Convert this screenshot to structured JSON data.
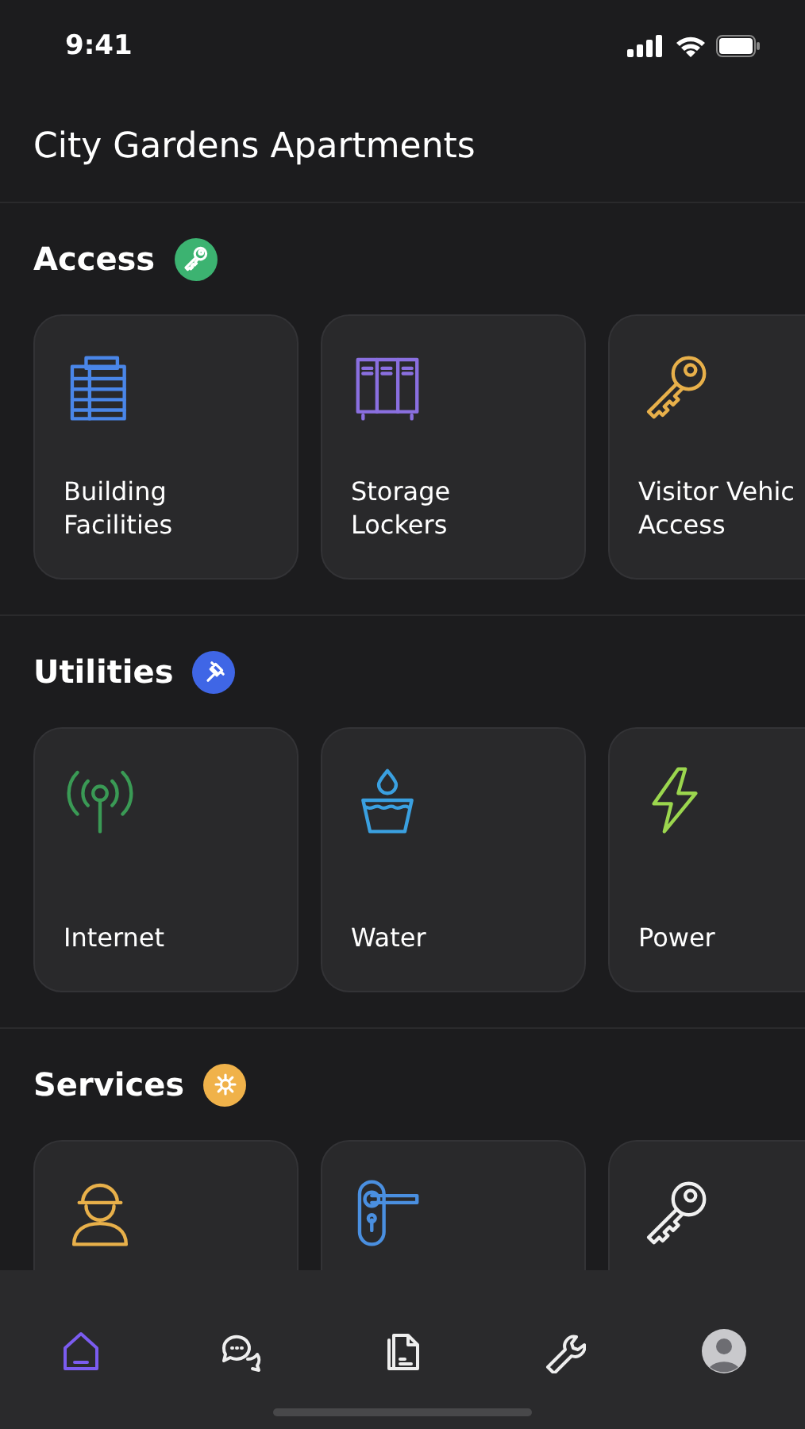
{
  "status_bar": {
    "time": "9:41"
  },
  "header": {
    "title": "City Gardens Apartments"
  },
  "sections": [
    {
      "title": "Access",
      "badge": {
        "kind": "key",
        "color": "#3cb371"
      },
      "cards": [
        {
          "label": "Building Facilities",
          "kind": "building",
          "color": "#4a86e8"
        },
        {
          "label": "Storage Lockers",
          "kind": "lockers",
          "color": "#8a6fe0"
        },
        {
          "label": "Visitor Vehic Access",
          "kind": "key",
          "color": "#e8b04a"
        }
      ]
    },
    {
      "title": "Utilities",
      "badge": {
        "kind": "plug",
        "color": "#3f66e6"
      },
      "cards": [
        {
          "label": "Internet",
          "kind": "antenna",
          "color": "#3a9a55"
        },
        {
          "label": "Water",
          "kind": "water",
          "color": "#3aa0e0"
        },
        {
          "label": "Power",
          "kind": "bolt",
          "color": "#9bd64e"
        }
      ]
    },
    {
      "title": "Services",
      "badge": {
        "kind": "gear",
        "color": "#f0b24a"
      },
      "cards": [
        {
          "kind": "worker",
          "color": "#e8b04a"
        },
        {
          "kind": "door",
          "color": "#4a8fe0"
        },
        {
          "kind": "key",
          "color": "#f0f0f0"
        }
      ]
    }
  ],
  "tab_bar": [
    {
      "kind": "home",
      "selected": true
    },
    {
      "kind": "chat",
      "selected": false
    },
    {
      "kind": "document",
      "selected": false
    },
    {
      "kind": "wrench",
      "selected": false
    },
    {
      "kind": "avatar",
      "selected": false
    }
  ]
}
